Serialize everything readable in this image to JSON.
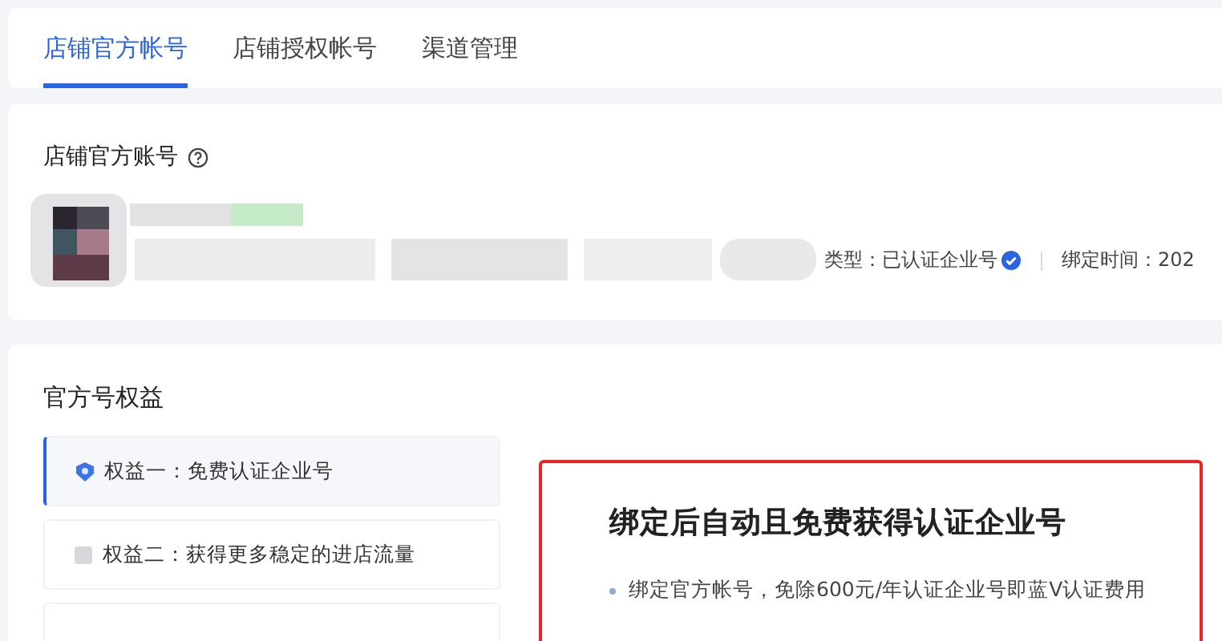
{
  "tabs": [
    {
      "label": "店铺官方帐号",
      "selected": true
    },
    {
      "label": "店铺授权帐号",
      "selected": false
    },
    {
      "label": "渠道管理",
      "selected": false
    }
  ],
  "account": {
    "title": "店铺官方账号",
    "type_text": "类型：已认证企业号",
    "verified": true,
    "bind_time": "绑定时间：202"
  },
  "benefits": {
    "title": "官方号权益",
    "items": [
      {
        "label": "权益一：免费认证企业号",
        "selected": true
      },
      {
        "label": "权益二：获得更多稳定的进店流量",
        "selected": false
      },
      {
        "selected": false
      }
    ],
    "detail": {
      "heading": "绑定后自动且免费获得认证企业号",
      "bullets": [
        "绑定官方帐号，免除600元/年认证企业号即蓝V认证费用"
      ]
    }
  }
}
